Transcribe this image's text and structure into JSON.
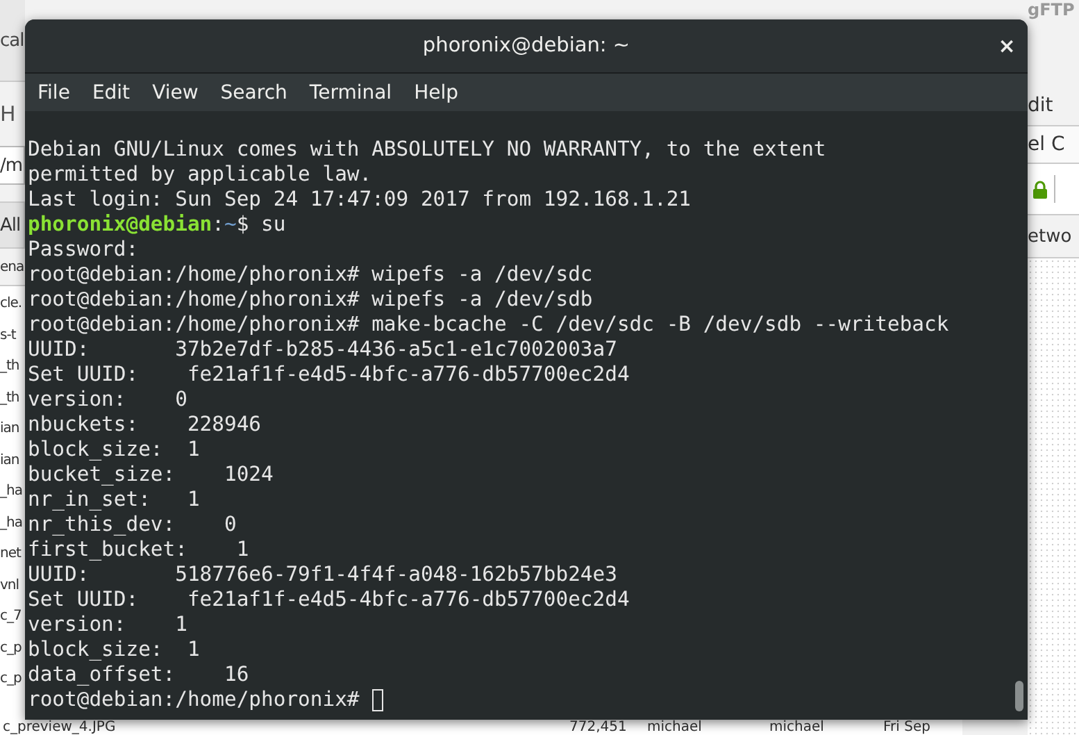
{
  "background_window": {
    "app_title": "gFTP",
    "left_labels": [
      {
        "text": "cal",
        "kind": "header"
      },
      {
        "text": "H",
        "kind": "toolbar"
      },
      {
        "text": "/m",
        "kind": "field"
      },
      {
        "text": "All",
        "kind": "filter"
      },
      {
        "text": "ena",
        "kind": "column"
      }
    ],
    "left_files": [
      "cle.",
      "s-t",
      "_th",
      "_th",
      "ian",
      "ian",
      "_ha",
      "_ha",
      "net",
      "vnl",
      "c_7",
      "c_p",
      "c_p"
    ],
    "right_labels": [
      {
        "text": "dit",
        "kind": "menu"
      },
      {
        "text": "el C",
        "kind": "toolbar"
      },
      {
        "kind": "lock"
      },
      {
        "text": "etwo",
        "kind": "column"
      }
    ],
    "bottom_row": [
      "c_preview_4.JPG",
      "772,451",
      "michael",
      "michael",
      "Fri Sep"
    ]
  },
  "terminal": {
    "title": "phoronix@debian: ~",
    "close": "×",
    "menu": [
      "File",
      "Edit",
      "View",
      "Search",
      "Terminal",
      "Help"
    ],
    "lines": [
      {
        "segments": [
          {
            "text": "Debian GNU/Linux comes with ABSOLUTELY NO WARRANTY, to the extent",
            "kind": "plain"
          }
        ]
      },
      {
        "segments": [
          {
            "text": "permitted by applicable law.",
            "kind": "plain"
          }
        ]
      },
      {
        "segments": [
          {
            "text": "Last login: Sun Sep 24 17:47:09 2017 from 192.168.1.21",
            "kind": "plain"
          }
        ]
      },
      {
        "segments": [
          {
            "text": "phoronix@debian",
            "kind": "user"
          },
          {
            "text": ":",
            "kind": "plain"
          },
          {
            "text": "~",
            "kind": "path"
          },
          {
            "text": "$ su",
            "kind": "plain"
          }
        ]
      },
      {
        "segments": [
          {
            "text": "Password:",
            "kind": "plain"
          }
        ]
      },
      {
        "segments": [
          {
            "text": "root@debian:/home/phoronix# wipefs -a /dev/sdc",
            "kind": "plain"
          }
        ]
      },
      {
        "segments": [
          {
            "text": "root@debian:/home/phoronix# wipefs -a /dev/sdb",
            "kind": "plain"
          }
        ]
      },
      {
        "segments": [
          {
            "text": "root@debian:/home/phoronix# make-bcache -C /dev/sdc -B /dev/sdb --writeback",
            "kind": "plain"
          }
        ]
      },
      {
        "segments": [
          {
            "text": "UUID:       37b2e7df-b285-4436-a5c1-e1c7002003a7",
            "kind": "plain"
          }
        ]
      },
      {
        "segments": [
          {
            "text": "Set UUID:    fe21af1f-e4d5-4bfc-a776-db57700ec2d4",
            "kind": "plain"
          }
        ]
      },
      {
        "segments": [
          {
            "text": "version:    0",
            "kind": "plain"
          }
        ]
      },
      {
        "segments": [
          {
            "text": "nbuckets:    228946",
            "kind": "plain"
          }
        ]
      },
      {
        "segments": [
          {
            "text": "block_size:  1",
            "kind": "plain"
          }
        ]
      },
      {
        "segments": [
          {
            "text": "bucket_size:    1024",
            "kind": "plain"
          }
        ]
      },
      {
        "segments": [
          {
            "text": "nr_in_set:   1",
            "kind": "plain"
          }
        ]
      },
      {
        "segments": [
          {
            "text": "nr_this_dev:    0",
            "kind": "plain"
          }
        ]
      },
      {
        "segments": [
          {
            "text": "first_bucket:    1",
            "kind": "plain"
          }
        ]
      },
      {
        "segments": [
          {
            "text": "UUID:       518776e6-79f1-4f4f-a048-162b57bb24e3",
            "kind": "plain"
          }
        ]
      },
      {
        "segments": [
          {
            "text": "Set UUID:    fe21af1f-e4d5-4bfc-a776-db57700ec2d4",
            "kind": "plain"
          }
        ]
      },
      {
        "segments": [
          {
            "text": "version:    1",
            "kind": "plain"
          }
        ]
      },
      {
        "segments": [
          {
            "text": "block_size:  1",
            "kind": "plain"
          }
        ]
      },
      {
        "segments": [
          {
            "text": "data_offset:    16",
            "kind": "plain"
          }
        ]
      },
      {
        "segments": [
          {
            "text": "root@debian:/home/phoronix# ",
            "kind": "plain"
          }
        ],
        "cursor": true
      }
    ]
  }
}
